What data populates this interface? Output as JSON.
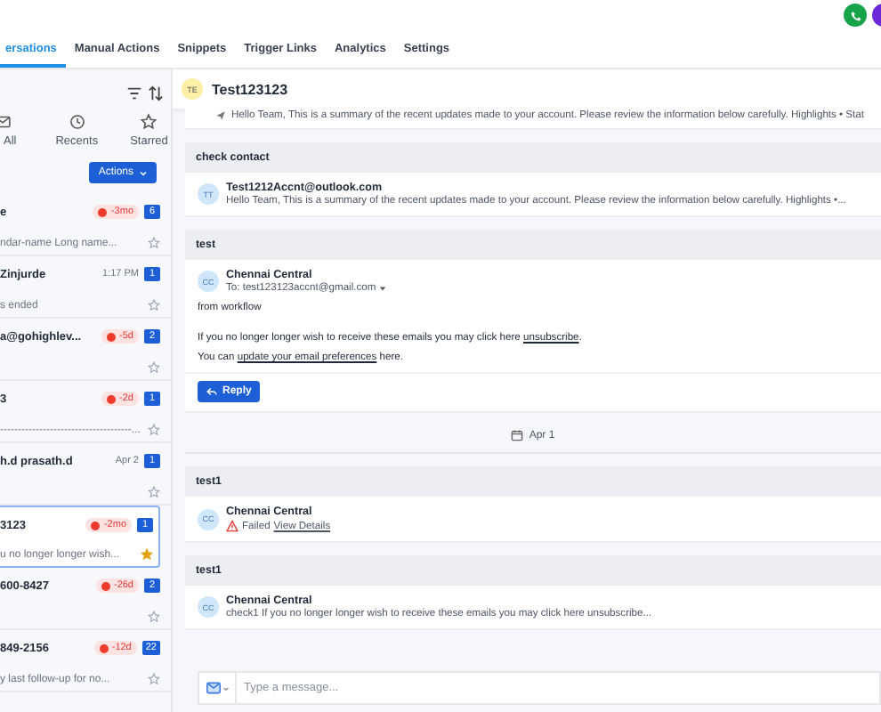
{
  "nav_tabs": [
    {
      "label": "ersations",
      "selected": true
    },
    {
      "label": "Manual Actions",
      "selected": false
    },
    {
      "label": "Snippets",
      "selected": false
    },
    {
      "label": "Trigger Links",
      "selected": false
    },
    {
      "label": "Analytics",
      "selected": false
    },
    {
      "label": "Settings",
      "selected": false
    }
  ],
  "list_filters": [
    {
      "label": "All"
    },
    {
      "label": "Recents"
    },
    {
      "label": "Starred"
    }
  ],
  "actions_button": "Actions",
  "conversations": [
    {
      "name": "e",
      "kind": "overdue",
      "meta": "-3mo",
      "count": "6",
      "preview": "ndar-name Long name...",
      "starred": false,
      "selected": false
    },
    {
      "name": "Zinjurde",
      "kind": "time",
      "meta": "1:17 PM",
      "count": "1",
      "preview": "s ended",
      "starred": false,
      "selected": false
    },
    {
      "name": "a@gohighlev...",
      "kind": "overdue",
      "meta": "-5d",
      "count": "2",
      "starred": false,
      "selected": false
    },
    {
      "name": "3",
      "kind": "overdue",
      "meta": "-2d",
      "count": "1",
      "preview": "-------------------------------------...",
      "starred": false,
      "selected": false
    },
    {
      "name": "h.d prasath.d",
      "kind": "time",
      "meta": "Apr 2",
      "count": "1",
      "starred": false,
      "selected": false
    },
    {
      "name": "3123",
      "kind": "overdue",
      "meta": "-2mo",
      "count": "1",
      "preview": "u no longer longer wish...",
      "starred": true,
      "selected": true
    },
    {
      "name": "600-8427",
      "kind": "overdue",
      "meta": "-26d",
      "count": "2",
      "starred": false,
      "selected": false
    },
    {
      "name": "849-2156",
      "kind": "overdue",
      "meta": "-12d",
      "count": "22",
      "preview": "y last follow-up for no...",
      "starred": false,
      "selected": false
    }
  ],
  "chat": {
    "avatar": "TE",
    "title": "Test123123",
    "messages": [
      {
        "kind": "snippet",
        "text": "Hello Team, This is a summary of the recent updates made to your account. Please review the information below carefully. Highlights • Stat"
      },
      {
        "kind": "preview",
        "subject": "check contact",
        "avatar": "TT",
        "sender": "Test1212Accnt@outlook.com",
        "text": "Hello Team, This is a summary of the recent updates made to your account. Please review the information below carefully. Highlights •..."
      },
      {
        "kind": "email",
        "subject": "test",
        "avatar": "CC",
        "sender": "Chennai Central",
        "to": "To: test123123accnt@gmail.com",
        "lines": [
          "from workflow",
          "If you no longer longer wish to receive these emails you may click here **unsubscribe**.",
          "You can **update your email preferences** here."
        ],
        "reply": "Reply"
      },
      {
        "kind": "date",
        "text": "Apr 1"
      },
      {
        "kind": "failed",
        "subject": "test1",
        "avatar": "CC",
        "sender": "Chennai Central",
        "status": "Failed",
        "link": "View Details"
      },
      {
        "kind": "preview",
        "subject": "test1",
        "avatar": "CC",
        "sender": "Chennai Central",
        "text": "check1 If you no longer longer wish to receive these emails you may click here unsubscribe..."
      }
    ],
    "composer": {
      "placeholder": "Type a message..."
    }
  }
}
